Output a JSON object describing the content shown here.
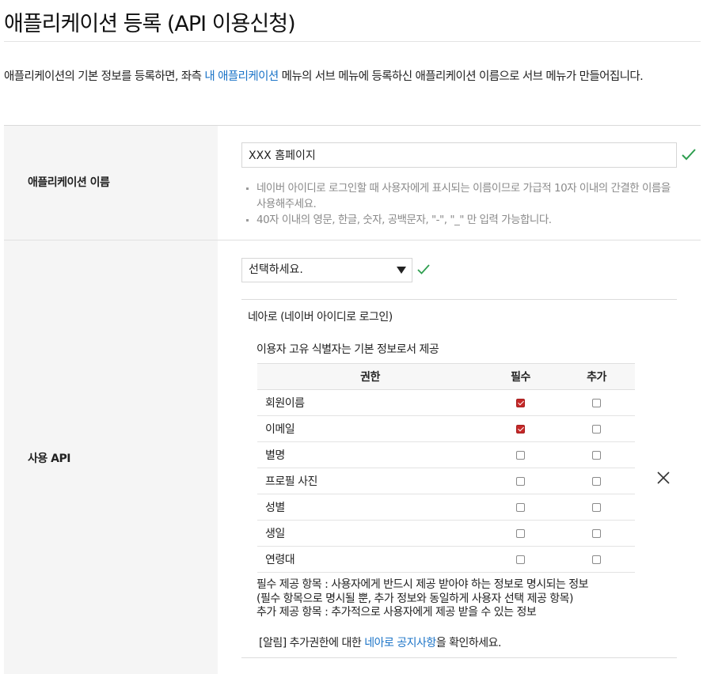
{
  "page": {
    "title": "애플리케이션 등록 (API 이용신청)",
    "intro_before": "애플리케이션의 기본 정보를 등록하면, 좌측 ",
    "intro_link": "내 애플리케이션",
    "intro_after": " 메뉴의 서브 메뉴에 등록하신 애플리케이션 이름으로 서브 메뉴가 만들어집니다."
  },
  "app_name": {
    "label": "애플리케이션 이름",
    "value": "XXX 홈페이지",
    "hints": [
      "네이버 아이디로 로그인할 때 사용자에게 표시되는 이름이므로 가급적 10자 이내의 간결한 이름을 사용해주세요.",
      "40자 이내의 영문, 한글, 숫자, 공백문자, \"-\", \"_\" 만 입력 가능합니다."
    ]
  },
  "api": {
    "label": "사용 API",
    "select_value": "선택하세요.",
    "name": "네아로 (네이버 아이디로 로그인)",
    "desc": "이용자 고유 식별자는 기본 정보로서 제공",
    "table": {
      "headers": [
        "권한",
        "필수",
        "추가"
      ],
      "rows": [
        {
          "name": "회원이름",
          "required": true,
          "additional": false
        },
        {
          "name": "이메일",
          "required": true,
          "additional": false
        },
        {
          "name": "별명",
          "required": false,
          "additional": false
        },
        {
          "name": "프로필 사진",
          "required": false,
          "additional": false
        },
        {
          "name": "성별",
          "required": false,
          "additional": false
        },
        {
          "name": "생일",
          "required": false,
          "additional": false
        },
        {
          "name": "연령대",
          "required": false,
          "additional": false
        }
      ]
    },
    "notes": [
      "필수 제공 항목 : 사용자에게 반드시 제공 받아야 하는 정보로 명시되는 정보",
      "(필수 항목으로 명시될 뿐, 추가 정보와 동일하게 사용자 선택 제공 항목)",
      "추가 제공 항목 : 추가적으로 사용자에게 제공 받을 수 있는 정보"
    ],
    "notice_before": "[알림] 추가권한에 대한 ",
    "notice_link": "네아로 공지사항",
    "notice_after": "을 확인하세요."
  },
  "colors": {
    "link": "#1a73c7",
    "check_green": "#2e9e4f",
    "checkbox_checked": "#c62828"
  },
  "icons": [
    "check-icon",
    "chevron-down-icon",
    "close-icon"
  ]
}
